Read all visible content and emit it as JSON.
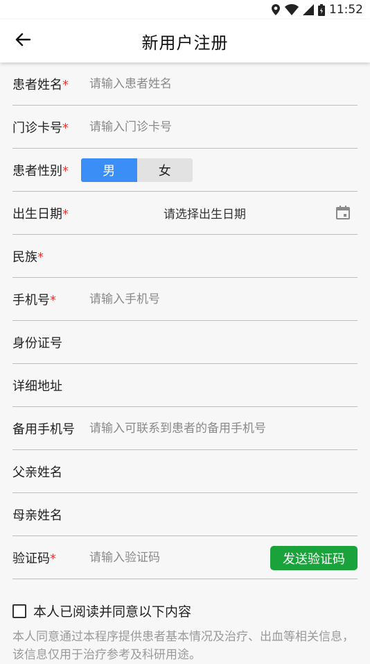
{
  "status_bar": {
    "time": "11:52",
    "icons": [
      "location-icon",
      "wifi-icon",
      "signal-icon",
      "battery-icon"
    ]
  },
  "header": {
    "title": "新用户注册",
    "back_icon": "arrow-left-icon"
  },
  "form": {
    "patient_name": {
      "label": "患者姓名",
      "required": "*",
      "placeholder": "请输入患者姓名",
      "value": ""
    },
    "clinic_card": {
      "label": "门诊卡号",
      "required": "*",
      "placeholder": "请输入门诊卡号",
      "value": ""
    },
    "gender": {
      "label": "患者性别",
      "required": "*",
      "options": [
        "男",
        "女"
      ],
      "selected": "男"
    },
    "birth_date": {
      "label": "出生日期",
      "required": "*",
      "placeholder": "请选择出生日期",
      "icon": "calendar-icon"
    },
    "ethnicity": {
      "label": "民族",
      "required": "*",
      "value": ""
    },
    "phone": {
      "label": "手机号",
      "required": "*",
      "placeholder": "请输入手机号",
      "value": ""
    },
    "id_number": {
      "label": "身份证号",
      "value": ""
    },
    "address": {
      "label": "详细地址",
      "value": ""
    },
    "backup_phone": {
      "label": "备用手机号",
      "placeholder": "请输入可联系到患者的备用手机号",
      "value": ""
    },
    "father_name": {
      "label": "父亲姓名",
      "value": ""
    },
    "mother_name": {
      "label": "母亲姓名",
      "value": ""
    },
    "verify_code": {
      "label": "验证码",
      "required": "*",
      "placeholder": "请输入验证码",
      "value": "",
      "send_button": "发送验证码"
    }
  },
  "agreement": {
    "checkbox_label": "本人已阅读并同意以下内容",
    "checked": false,
    "notice": "本人同意通过本程序提供患者基本情况及治疗、出血等相关信息，该信息仅用于治疗参考及科研用途。"
  },
  "colors": {
    "accent_blue": "#3b8ef5",
    "button_green": "#1aa33a",
    "required_red": "#e53935"
  }
}
